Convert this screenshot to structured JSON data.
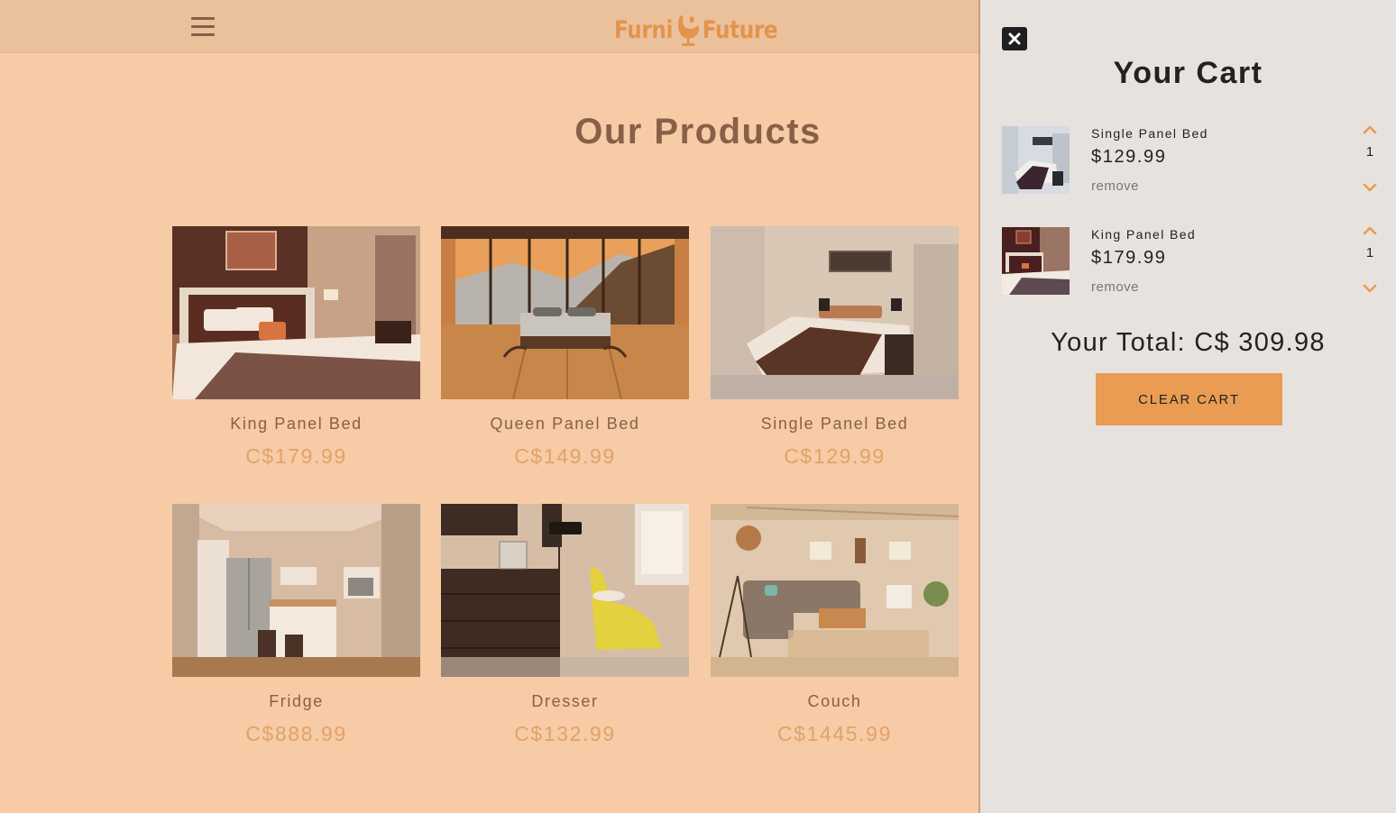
{
  "nav": {
    "menu_icon": "hamburger-icon",
    "logo_left": "Furni",
    "logo_right": "Future",
    "logo_icon": "egg-chair-icon"
  },
  "products_section": {
    "title": "Our Products",
    "items": [
      {
        "name": "King Panel Bed",
        "price": "C$179.99",
        "image": "bedroom-king-bed"
      },
      {
        "name": "Queen Panel Bed",
        "price": "C$149.99",
        "image": "bedroom-mountain-view"
      },
      {
        "name": "Single Panel Bed",
        "price": "C$129.99",
        "image": "bedroom-single-bed"
      },
      {
        "name": "Fridge",
        "price": "C$888.99",
        "image": "kitchen-fridge"
      },
      {
        "name": "Dresser",
        "price": "C$132.99",
        "image": "room-dresser-chaise"
      },
      {
        "name": "Couch",
        "price": "C$1445.99",
        "image": "living-room-couch"
      }
    ]
  },
  "cart": {
    "close_icon": "close-icon",
    "title": "Your Cart",
    "items": [
      {
        "name": "Single Panel Bed",
        "price": "$129.99",
        "remove_label": "remove",
        "quantity": "1"
      },
      {
        "name": "King Panel Bed",
        "price": "$179.99",
        "remove_label": "remove",
        "quantity": "1"
      }
    ],
    "total_text": "Your Total: C$ 309.98",
    "clear_label": "CLEAR CART"
  },
  "colors": {
    "overlay_tint": "#f6cba5",
    "accent": "#e99c52",
    "cart_bg": "#e7e2de"
  }
}
